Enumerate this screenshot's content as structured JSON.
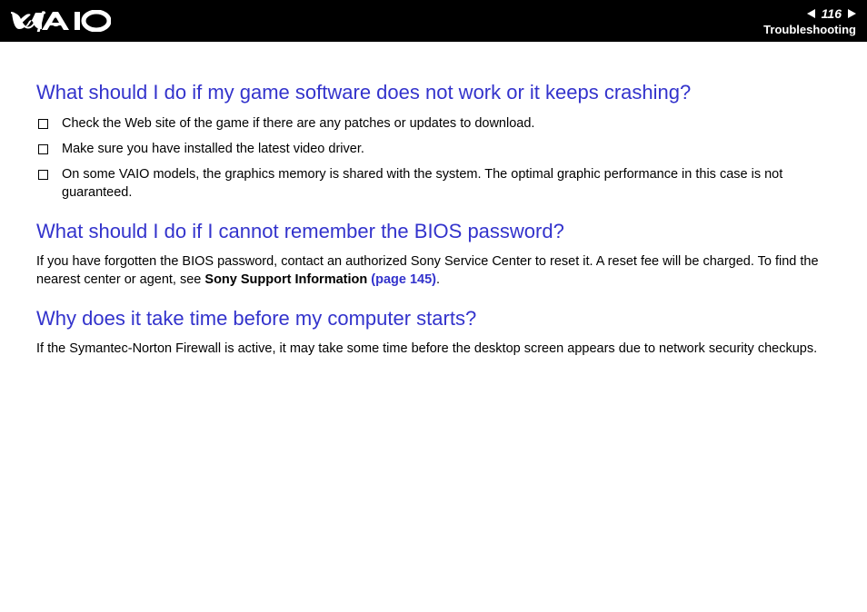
{
  "header": {
    "page_number": "116",
    "section": "Troubleshooting"
  },
  "content": {
    "q1": {
      "heading": "What should I do if my game software does not work or it keeps crashing?",
      "bullets": [
        "Check the Web site of the game if there are any patches or updates to download.",
        "Make sure you have installed the latest video driver.",
        "On some VAIO models, the graphics memory is shared with the system. The optimal graphic performance in this case is not guaranteed."
      ]
    },
    "q2": {
      "heading": "What should I do if I cannot remember the BIOS password?",
      "p1_a": "If you have forgotten the BIOS password, contact an authorized Sony Service Center to reset it. A reset fee will be charged. To find the nearest center or agent, see ",
      "p1_bold": "Sony Support Information ",
      "p1_link": "(page 145)",
      "p1_end": "."
    },
    "q3": {
      "heading": "Why does it take time before my computer starts?",
      "p1": "If the Symantec-Norton Firewall is active, it may take some time before the desktop screen appears due to network security checkups."
    }
  }
}
